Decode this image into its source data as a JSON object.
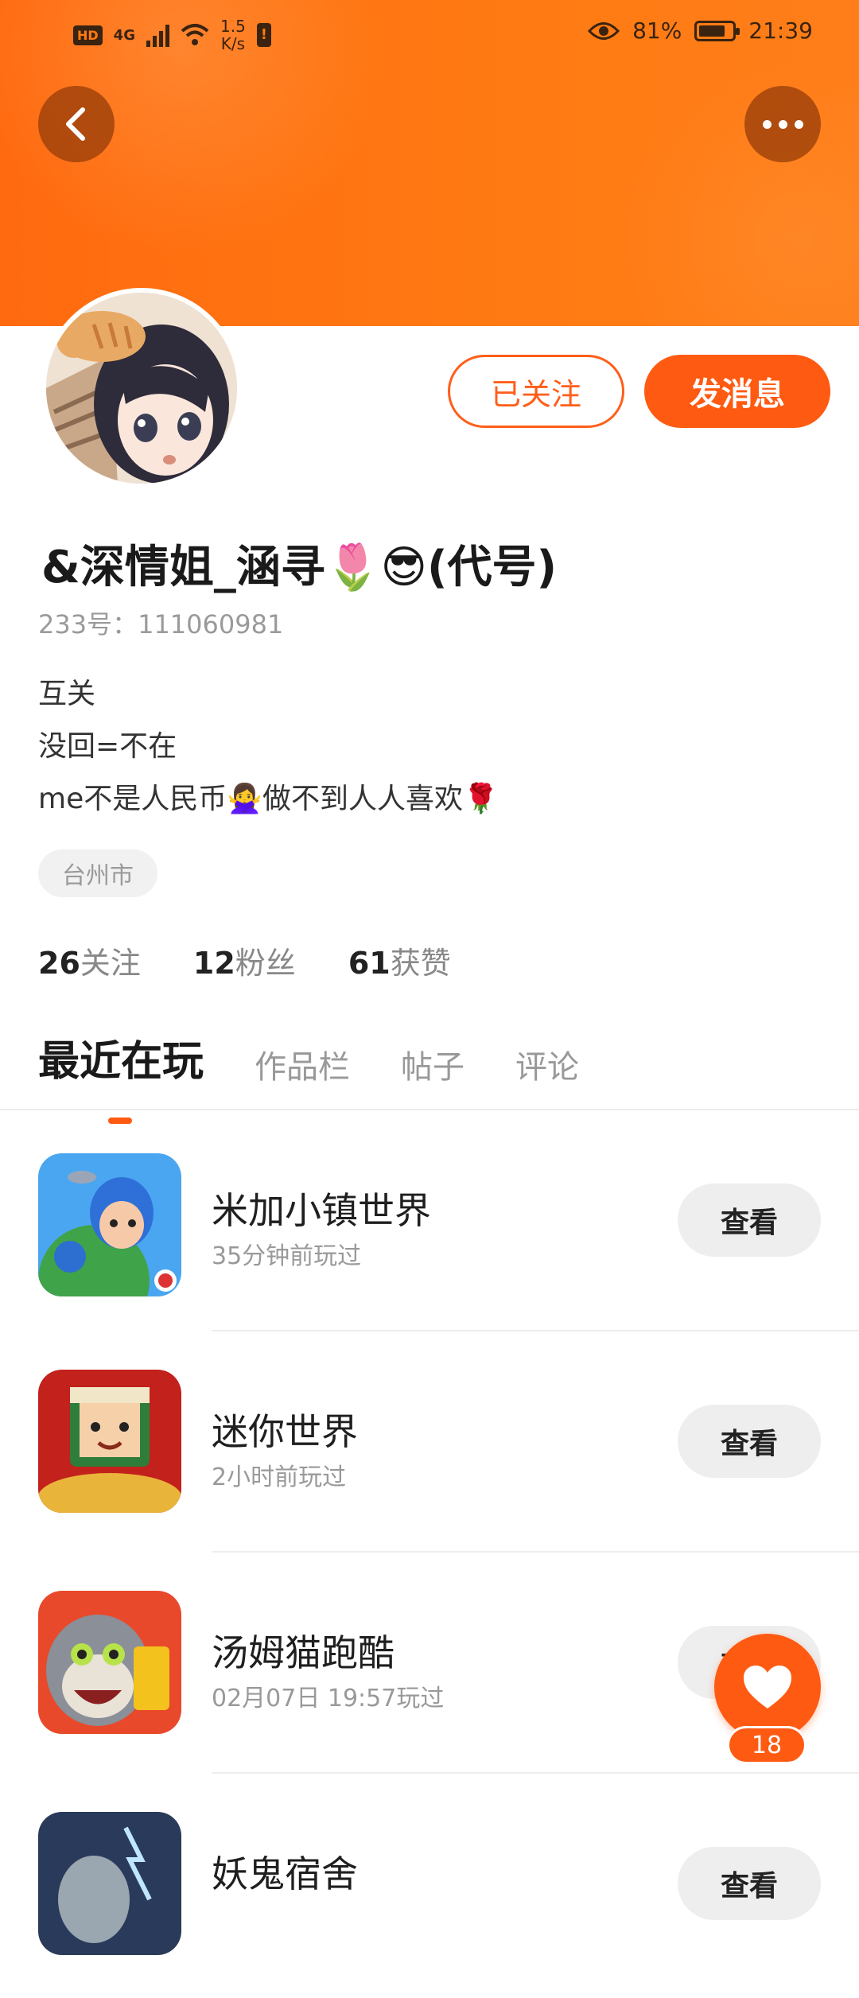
{
  "status_bar": {
    "hd": "HD",
    "network": "4G",
    "speed_value": "1.5",
    "speed_unit": "K/s",
    "battery": "81%",
    "time": "21:39"
  },
  "header": {
    "back_icon": "chevron-left-icon",
    "more_icon": "more-dots-icon"
  },
  "profile": {
    "follow_label": "已关注",
    "message_label": "发消息",
    "username": "&深情姐_涵寻🌷😎(代号)",
    "user_id": "233号：111060981",
    "bio_lines": [
      "互关",
      "没回=不在",
      "me不是人民币🙅‍♀️做不到人人喜欢🌹"
    ],
    "location": "台州市",
    "stats": [
      {
        "num": "26",
        "label": "关注"
      },
      {
        "num": "12",
        "label": "粉丝"
      },
      {
        "num": "61",
        "label": "获赞"
      }
    ]
  },
  "tabs": [
    "最近在玩",
    "作品栏",
    "帖子",
    "评论"
  ],
  "games": [
    {
      "name": "米加小镇世界",
      "time": "35分钟前玩过",
      "action": "查看"
    },
    {
      "name": "迷你世界",
      "time": "2小时前玩过",
      "action": "查看"
    },
    {
      "name": "汤姆猫跑酷",
      "time": "02月07日 19:57玩过",
      "action": "查看"
    },
    {
      "name": "妖鬼宿舍",
      "time": "",
      "action": "查看"
    }
  ],
  "like_fab": {
    "count": "18"
  },
  "colors": {
    "accent": "#ff5a12",
    "header": "#ff7a12"
  }
}
